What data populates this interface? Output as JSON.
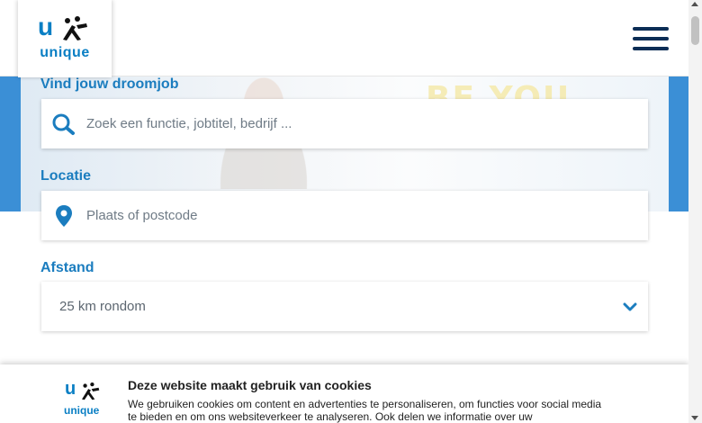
{
  "header": {
    "logo_text": "unique",
    "menu_icon": "hamburger-menu-icon"
  },
  "hero": {
    "banner_text": "BE YOU"
  },
  "search": {
    "label": "Vind jouw droomjob",
    "placeholder": "Zoek een functie, jobtitel, bedrijf ...",
    "value": "",
    "icon": "search-icon"
  },
  "location": {
    "label": "Locatie",
    "placeholder": "Plaats of postcode",
    "value": "",
    "icon": "map-pin-icon"
  },
  "distance": {
    "label": "Afstand",
    "selected": "25 km rondom",
    "icon": "chevron-down-icon"
  },
  "cookie": {
    "title": "Deze website maakt gebruik van cookies",
    "body": "We gebruiken cookies om content en advertenties te personaliseren, om functies voor social media te bieden en om ons websiteverkeer te analyseren. Ook delen we informatie over uw",
    "logo_text": "unique"
  },
  "colors": {
    "brand_blue": "#0a7fc4",
    "label_blue": "#1b7dbf",
    "navy": "#0b2d55",
    "hero_blue": "#3b8fd6"
  }
}
